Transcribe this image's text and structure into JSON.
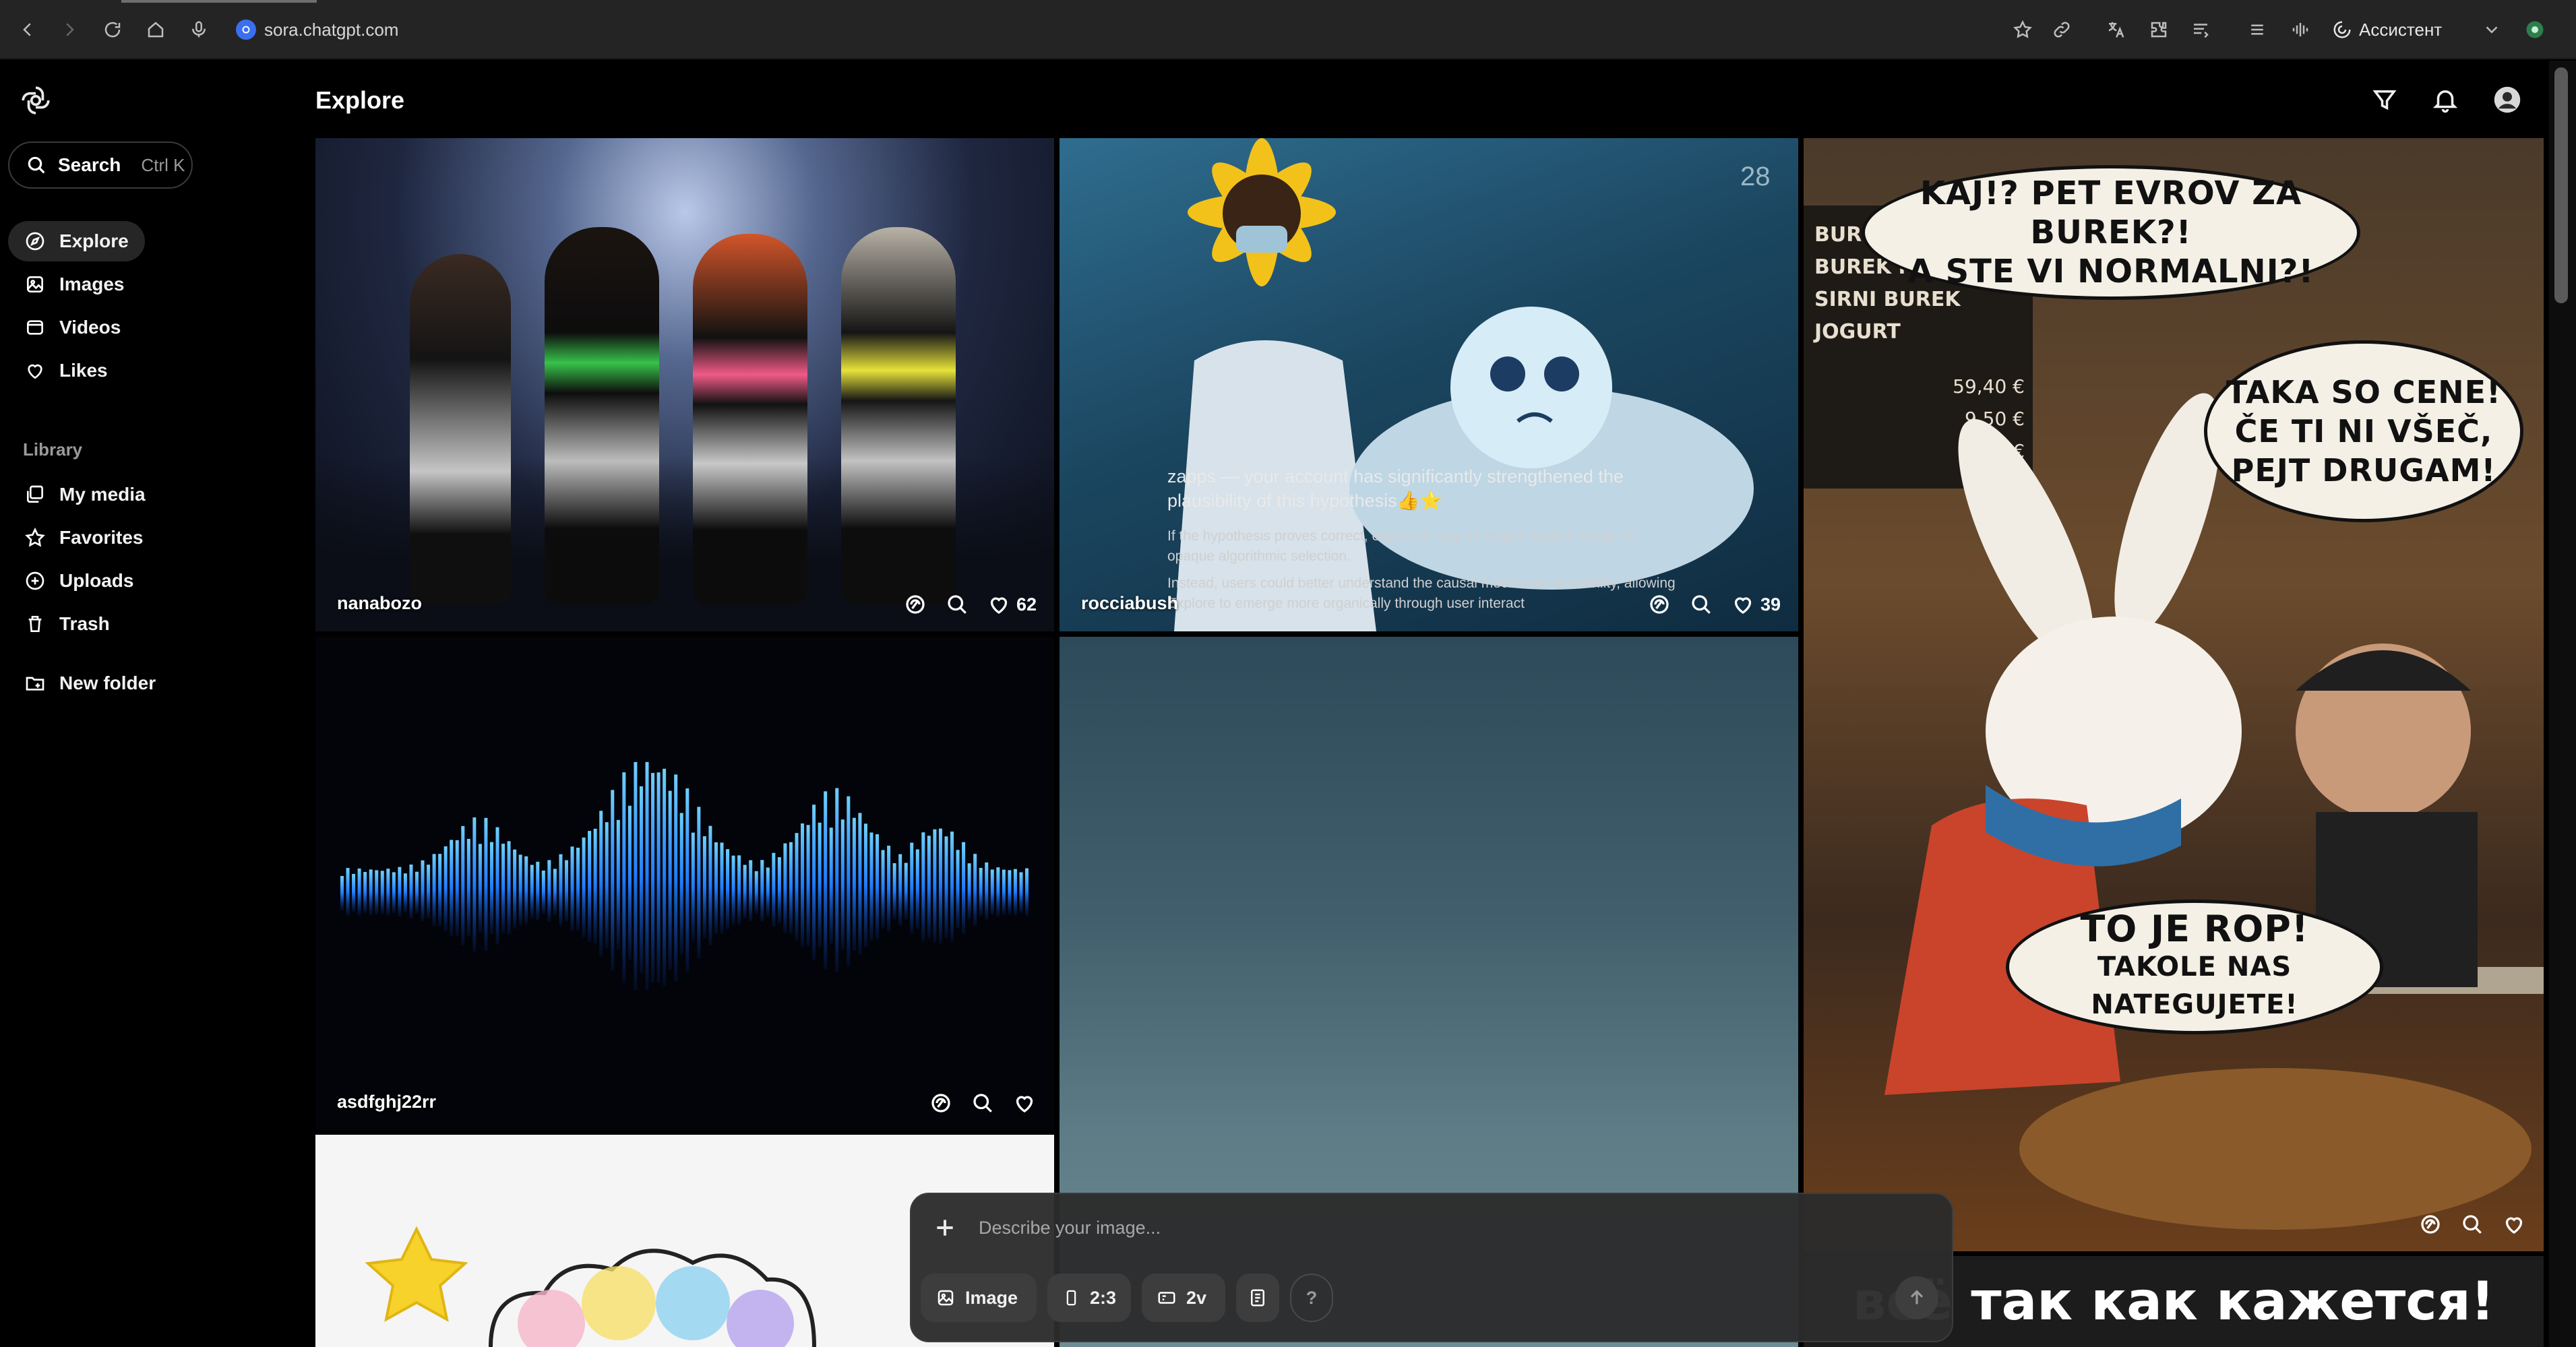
{
  "browser": {
    "url": "sora.chatgpt.com",
    "assistant_label": "Ассистент"
  },
  "sidebar": {
    "search_label": "Search",
    "search_shortcut": "Ctrl K",
    "nav": [
      {
        "label": "Explore",
        "icon": "compass-icon",
        "active": true
      },
      {
        "label": "Images",
        "icon": "image-icon"
      },
      {
        "label": "Videos",
        "icon": "video-icon"
      },
      {
        "label": "Likes",
        "icon": "heart-icon"
      }
    ],
    "library_heading": "Library",
    "library": [
      {
        "label": "My media",
        "icon": "media-icon"
      },
      {
        "label": "Favorites",
        "icon": "star-icon"
      },
      {
        "label": "Uploads",
        "icon": "upload-icon"
      },
      {
        "label": "Trash",
        "icon": "trash-icon"
      }
    ],
    "new_folder_label": "New folder"
  },
  "header": {
    "title": "Explore"
  },
  "feed": {
    "tiles": [
      {
        "user": "nanabozo",
        "likes": "62"
      },
      {
        "user": "rocciabush",
        "likes": "39",
        "overlay_heading": "zapps — your account has significantly strengthened the plausibility of this hypothesis👍⭐",
        "overlay_line1": "If the hypothesis proves correct, exposure may no longer depend solely on opaque algorithmic selection.",
        "overlay_line2": "Instead, users could better understand the causal mechanics of visibility, allowing Explore to emerge more organically through user interact"
      },
      {
        "user": "",
        "bubble1": [
          "KAJ!? PET EVROV ZA BUREK?!",
          "A STE VI NORMALNI?!"
        ],
        "bubble2": [
          "TAKA SO CENE!",
          "ČE TI NI VŠEČ,",
          "PEJT DRUGAM!"
        ],
        "bubble3": [
          "TO JE ROP!",
          "TAKOLE NAS NATEGUJETE!"
        ],
        "sign_lines": [
          "BUREK",
          "BUREK MESNI",
          "SIRNI BUREK",
          "JOGURT"
        ],
        "sign_prices": [
          "59,40 €",
          "9,50 €",
          "0 €"
        ]
      },
      {
        "user": "asdfghj22rr"
      },
      {
        "user": ""
      },
      {
        "user": ""
      },
      {
        "caption": "всё так как кажется!"
      }
    ]
  },
  "composer": {
    "placeholder": "Describe your image...",
    "mode_label": "Image",
    "aspect_label": "2:3",
    "variations_label": "2v",
    "help_label": "?"
  },
  "colors": {
    "background": "#000000",
    "chrome": "#242424",
    "composer": "#2c2c2c",
    "chip": "#3d3d3d"
  }
}
